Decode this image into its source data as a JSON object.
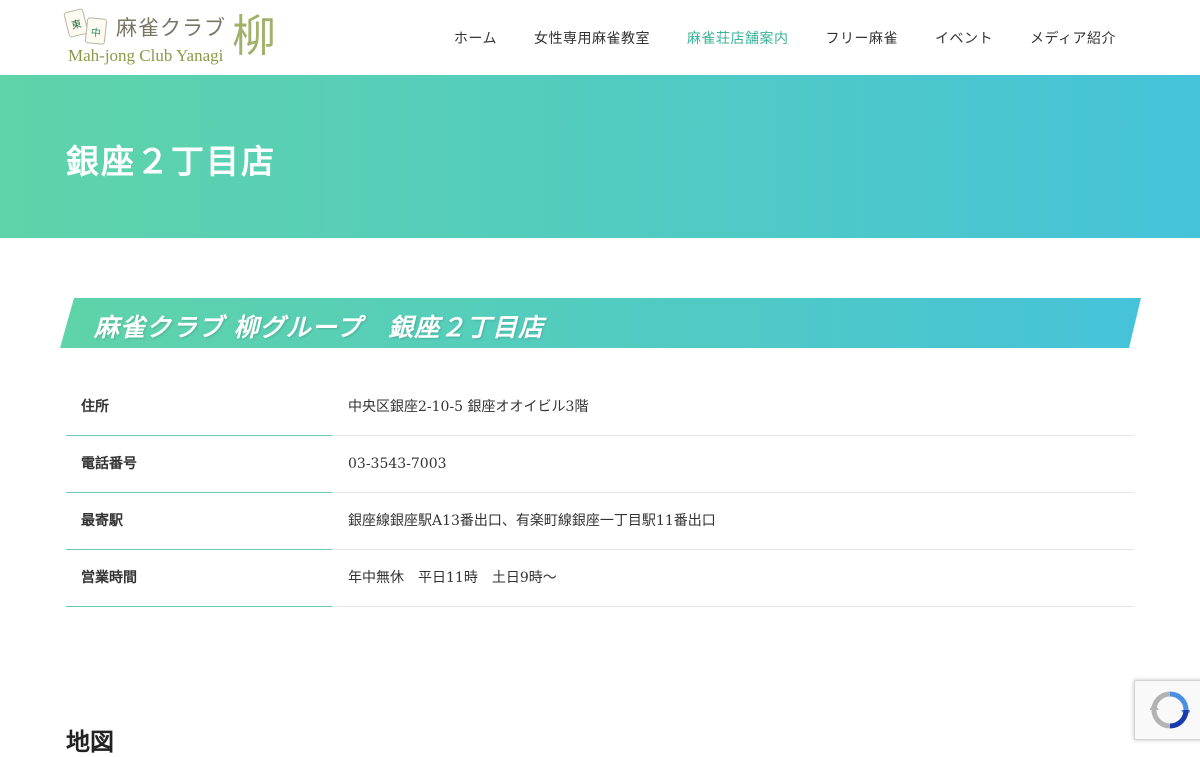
{
  "header": {
    "logo": {
      "tile_1": "東",
      "tile_2": "中",
      "title_jp": "麻雀クラブ",
      "title_en": "Mah-jong Club Yanagi",
      "title_kanji": "柳"
    },
    "nav": [
      {
        "label": "ホーム"
      },
      {
        "label": "女性専用麻雀教室"
      },
      {
        "label": "麻雀荘店舗案内"
      },
      {
        "label": "フリー麻雀"
      },
      {
        "label": "イベント"
      },
      {
        "label": "メディア紹介"
      }
    ]
  },
  "banner": {
    "title": "銀座２丁目店"
  },
  "shop": {
    "heading": "麻雀クラブ 柳グループ　銀座２丁目店",
    "info": [
      {
        "label": "住所",
        "value": "中央区銀座2-10-5 銀座オオイビル3階"
      },
      {
        "label": "電話番号",
        "value": "03-3543-7003"
      },
      {
        "label": "最寄駅",
        "value": "銀座線銀座駅A13番出口、有楽町線銀座一丁目駅11番出口"
      },
      {
        "label": "営業時間",
        "value": "年中無休　平日11時　土日9時〜"
      }
    ]
  },
  "map": {
    "heading": "地図"
  },
  "recaptcha": {
    "icon": "recaptcha-icon"
  },
  "colors": {
    "accent": "#3bb49a",
    "banner_start": "#5fd3a9",
    "banner_end": "#46c3d9"
  }
}
